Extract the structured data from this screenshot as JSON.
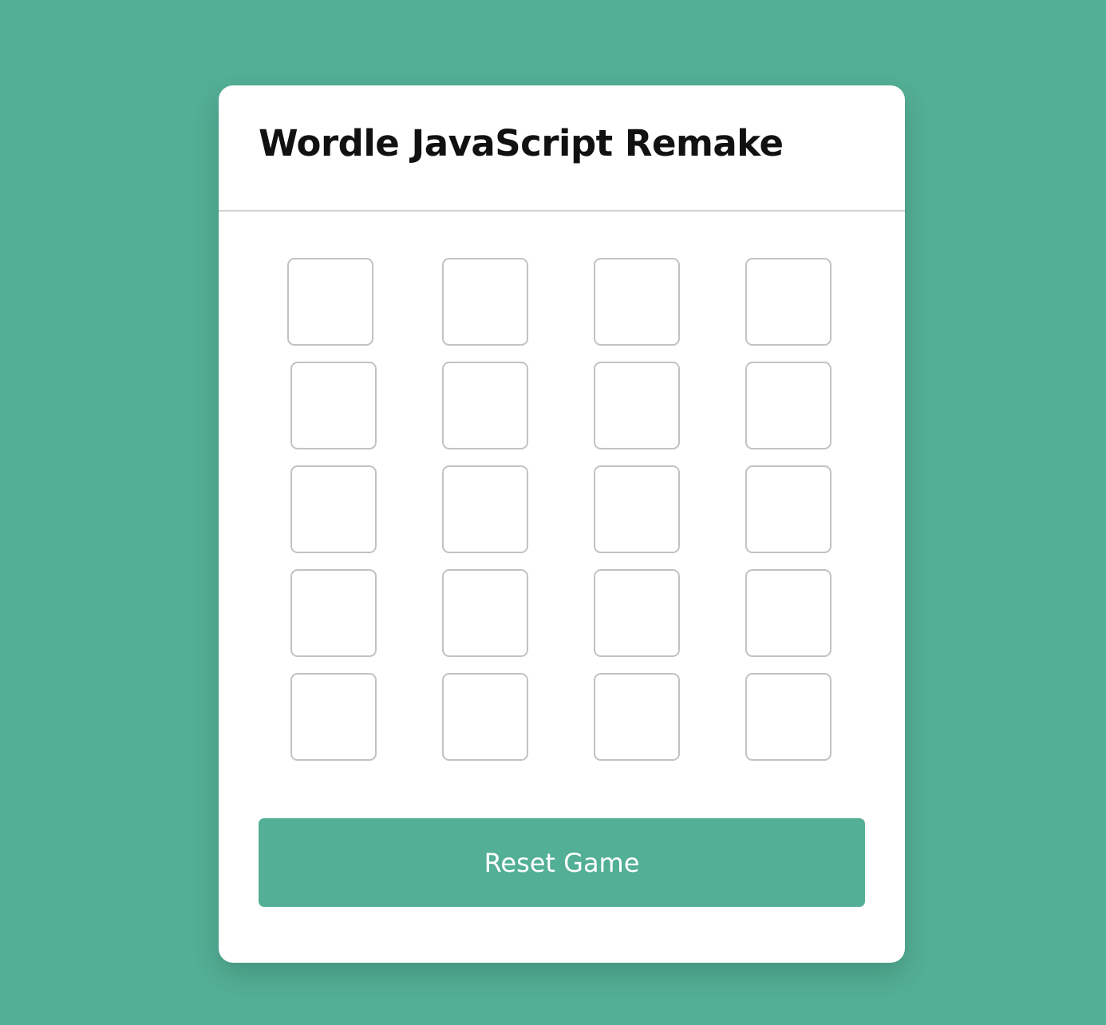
{
  "page": {
    "background_color": "#53af95",
    "accent_color": "#53af95"
  },
  "card": {
    "title": "Wordle JavaScript Remake"
  },
  "board": {
    "rows": 5,
    "columns": 4,
    "tiles": [
      [
        "",
        "",
        "",
        ""
      ],
      [
        "",
        "",
        "",
        ""
      ],
      [
        "",
        "",
        "",
        ""
      ],
      [
        "",
        "",
        "",
        ""
      ],
      [
        "",
        "",
        "",
        ""
      ]
    ]
  },
  "controls": {
    "reset_label": "Reset Game"
  }
}
